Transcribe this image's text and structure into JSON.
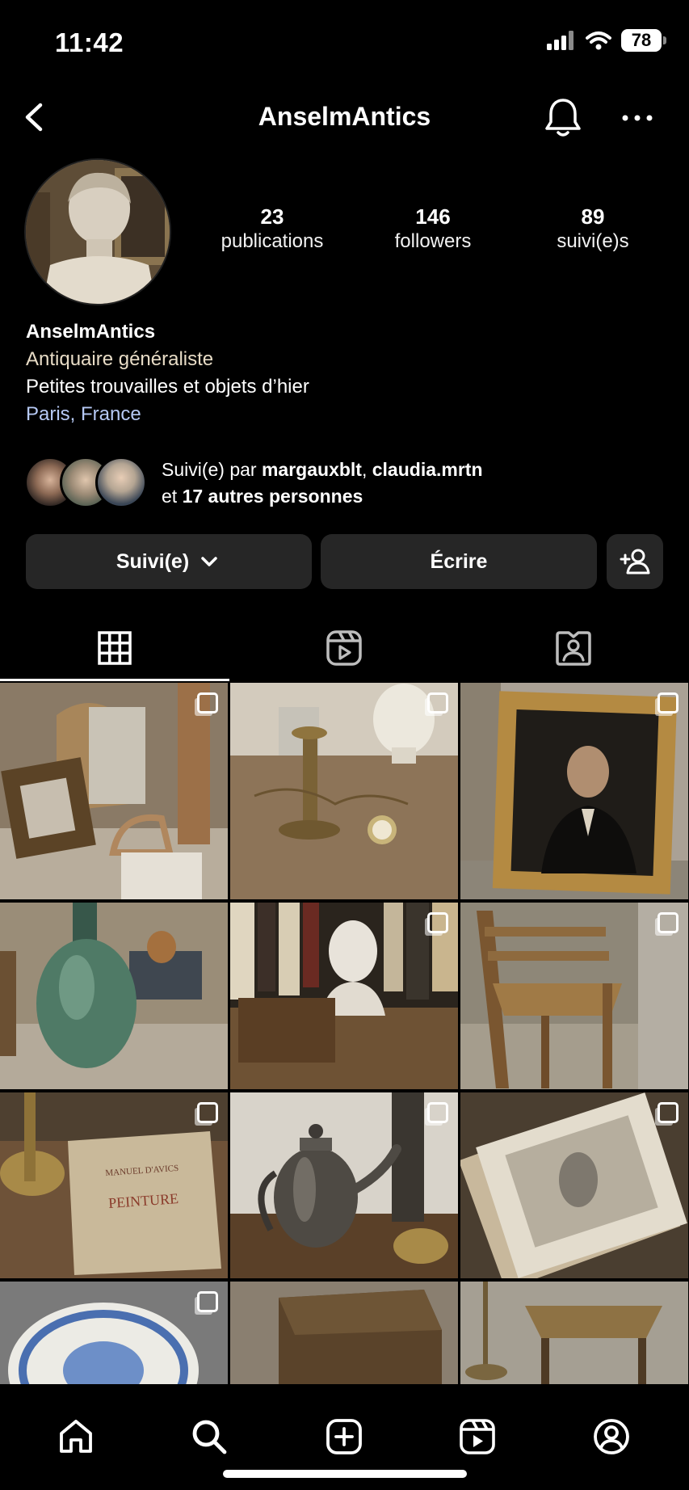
{
  "status_bar": {
    "time": "11:42",
    "battery": "78"
  },
  "header": {
    "title": "AnselmAntics"
  },
  "profile": {
    "stats": [
      {
        "number": "23",
        "label": "publications"
      },
      {
        "number": "146",
        "label": "followers"
      },
      {
        "number": "89",
        "label": "suivi(e)s"
      }
    ],
    "name": "AnselmAntics",
    "category": "Antiquaire généraliste",
    "bio": "Petites trouvailles et objets d’hier",
    "location": "Paris, France"
  },
  "followed_by": {
    "prefix": "Suivi(e) par ",
    "user1": "margauxblt",
    "separator": ", ",
    "user2": "claudia.mrtn",
    "line2_prefix": "et ",
    "others": "17 autres personnes"
  },
  "buttons": {
    "following": "Suivi(e)",
    "write": "Écrire"
  },
  "colors": {
    "background": "#000000",
    "button": "#262626",
    "category": "#e8dcc6",
    "location": "#b6c9f5"
  }
}
